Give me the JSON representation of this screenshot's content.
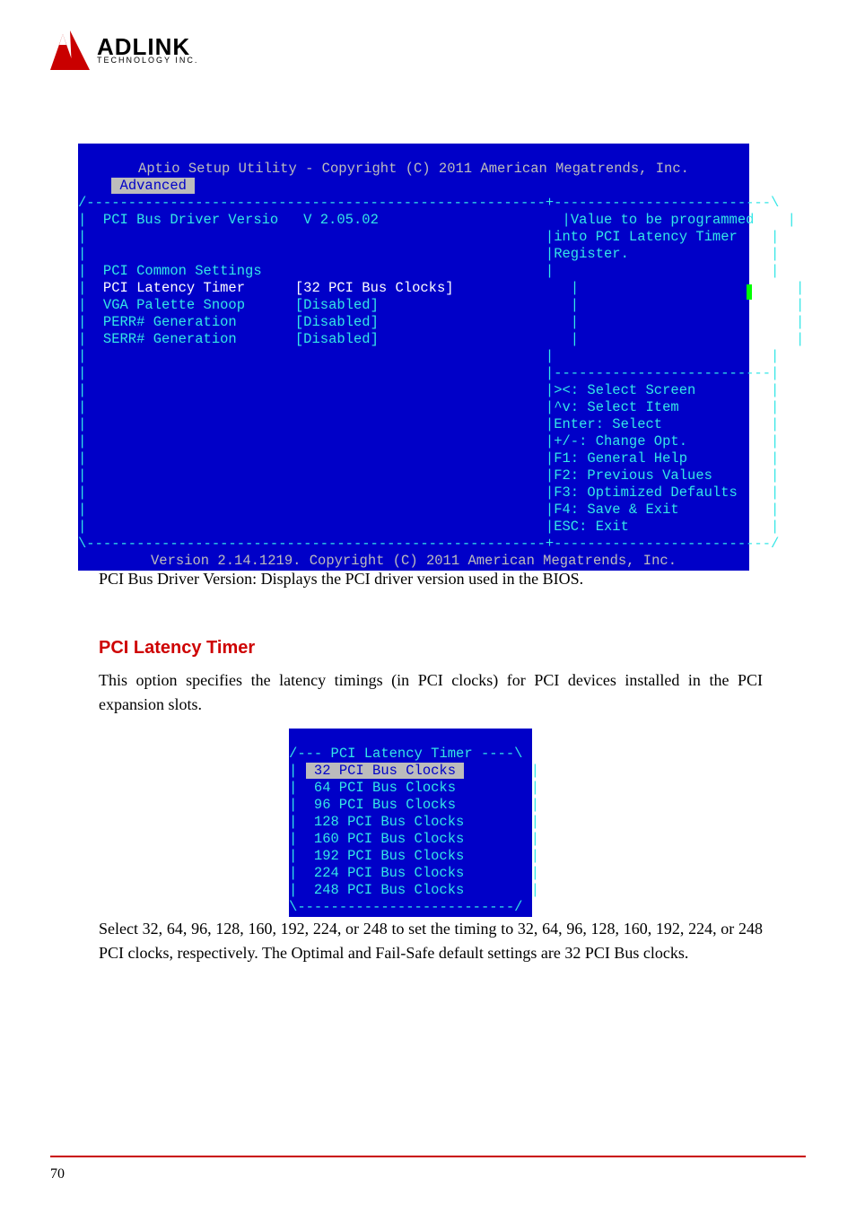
{
  "logo": {
    "top": "ADLINK",
    "bot": "TECHNOLOGY INC."
  },
  "bios1": {
    "title": "Aptio Setup Utility - Copyright (C) 2011 American Megatrends, Inc.",
    "tab": " Advanced ",
    "left": {
      "versio_label": "PCI Bus Driver Versio",
      "versio_val": "V 2.05.02",
      "section": "PCI Common Settings",
      "lat_label": "PCI Latency Timer",
      "lat_val": "[32 PCI Bus Clocks]",
      "vga_label": "VGA Palette Snoop",
      "vga_val": "[Disabled]",
      "perr_label": "PERR# Generation",
      "perr_val": "[Disabled]",
      "serr_label": "SERR# Generation",
      "serr_val": "[Disabled]"
    },
    "right": {
      "help1": "Value to be programmed",
      "help2": "into PCI Latency Timer",
      "help3": "Register.",
      "k1": "><: Select Screen",
      "k2": "^v: Select Item",
      "k3": "Enter: Select",
      "k4": "+/-: Change Opt.",
      "k5": "F1: General Help",
      "k6": "F2: Previous Values",
      "k7": "F3: Optimized Defaults",
      "k8": "F4: Save & Exit",
      "k9": "ESC: Exit"
    },
    "footer": "Version 2.14.1219. Copyright (C) 2011 American Megatrends, Inc."
  },
  "para1": "PCI Bus Driver Version: Displays the PCI driver version used in the BIOS.",
  "head1": "PCI Latency Timer",
  "para2": "This option specifies the latency timings (in PCI clocks) for PCI devices installed in the PCI expansion slots.",
  "optbox": {
    "title": "--- PCI Latency Timer ----",
    "opts": [
      " 32 PCI Bus Clocks ",
      "64 PCI Bus Clocks",
      "96 PCI Bus Clocks",
      "128 PCI Bus Clocks",
      "160 PCI Bus Clocks",
      "192 PCI Bus Clocks",
      "224 PCI Bus Clocks",
      "248 PCI Bus Clocks"
    ],
    "bottom": "--------------------------"
  },
  "para3": "Select 32, 64, 96, 128, 160, 192, 224, or 248 to set the timing to 32, 64, 96, 128, 160, 192, 224, or 248 PCI clocks, respectively. The Optimal and Fail-Safe default settings are 32 PCI Bus clocks.",
  "page_num": "70"
}
